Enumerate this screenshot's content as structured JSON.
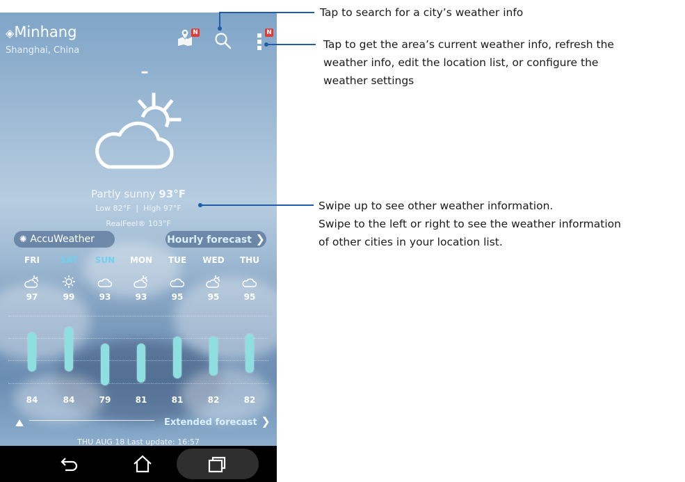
{
  "location": {
    "city": "Minhang",
    "region": "Shanghai, China"
  },
  "header_icons": {
    "map_badge": "N",
    "menu_badge": "N",
    "search_icon": "search-icon",
    "menu_icon": "menu-icon",
    "map_icon": "map-pin-icon"
  },
  "current": {
    "condition": "Partly sunny",
    "temp": "93°F",
    "low": "Low 82°F",
    "separator": "|",
    "high": "High 97°F",
    "realfeel": "RealFeel® 103°F",
    "dash": "–"
  },
  "brand": {
    "name": "AccuWeather"
  },
  "links": {
    "hourly": "Hourly forecast",
    "extended": "Extended forecast"
  },
  "forecast": [
    {
      "day": "FRI",
      "high": "97",
      "low": "84",
      "icon": "partly-sunny-icon",
      "highlight": false
    },
    {
      "day": "SAT",
      "high": "99",
      "low": "84",
      "icon": "sunny-icon",
      "highlight": true
    },
    {
      "day": "SUN",
      "high": "93",
      "low": "79",
      "icon": "cloudy-icon",
      "highlight": true
    },
    {
      "day": "MON",
      "high": "93",
      "low": "81",
      "icon": "partly-sunny-icon",
      "highlight": false
    },
    {
      "day": "TUE",
      "high": "95",
      "low": "81",
      "icon": "cloudy-icon",
      "highlight": false
    },
    {
      "day": "WED",
      "high": "95",
      "low": "82",
      "icon": "partly-sunny-icon",
      "highlight": false
    },
    {
      "day": "THU",
      "high": "95",
      "low": "82",
      "icon": "cloudy-icon",
      "highlight": false
    }
  ],
  "footer": {
    "last_update": "THU AUG 18 Last update: 16:57"
  },
  "annotations": {
    "search": "Tap to search for a city’s weather info",
    "menu_line1": "Tap to get the area’s current weather info, refresh the",
    "menu_line2": "weather info, edit the location list, or configure the",
    "menu_line3": "weather settings",
    "swipe_line1": "Swipe up to see other weather information.",
    "swipe_line2": "Swipe to the left or right to see the weather information",
    "swipe_line3": "of other cities in your location list."
  },
  "colors": {
    "annotation_line": "#1f5da8",
    "badge": "#e53935",
    "bar": "#8ee0e0",
    "highlight_day": "#6fd0f0"
  }
}
